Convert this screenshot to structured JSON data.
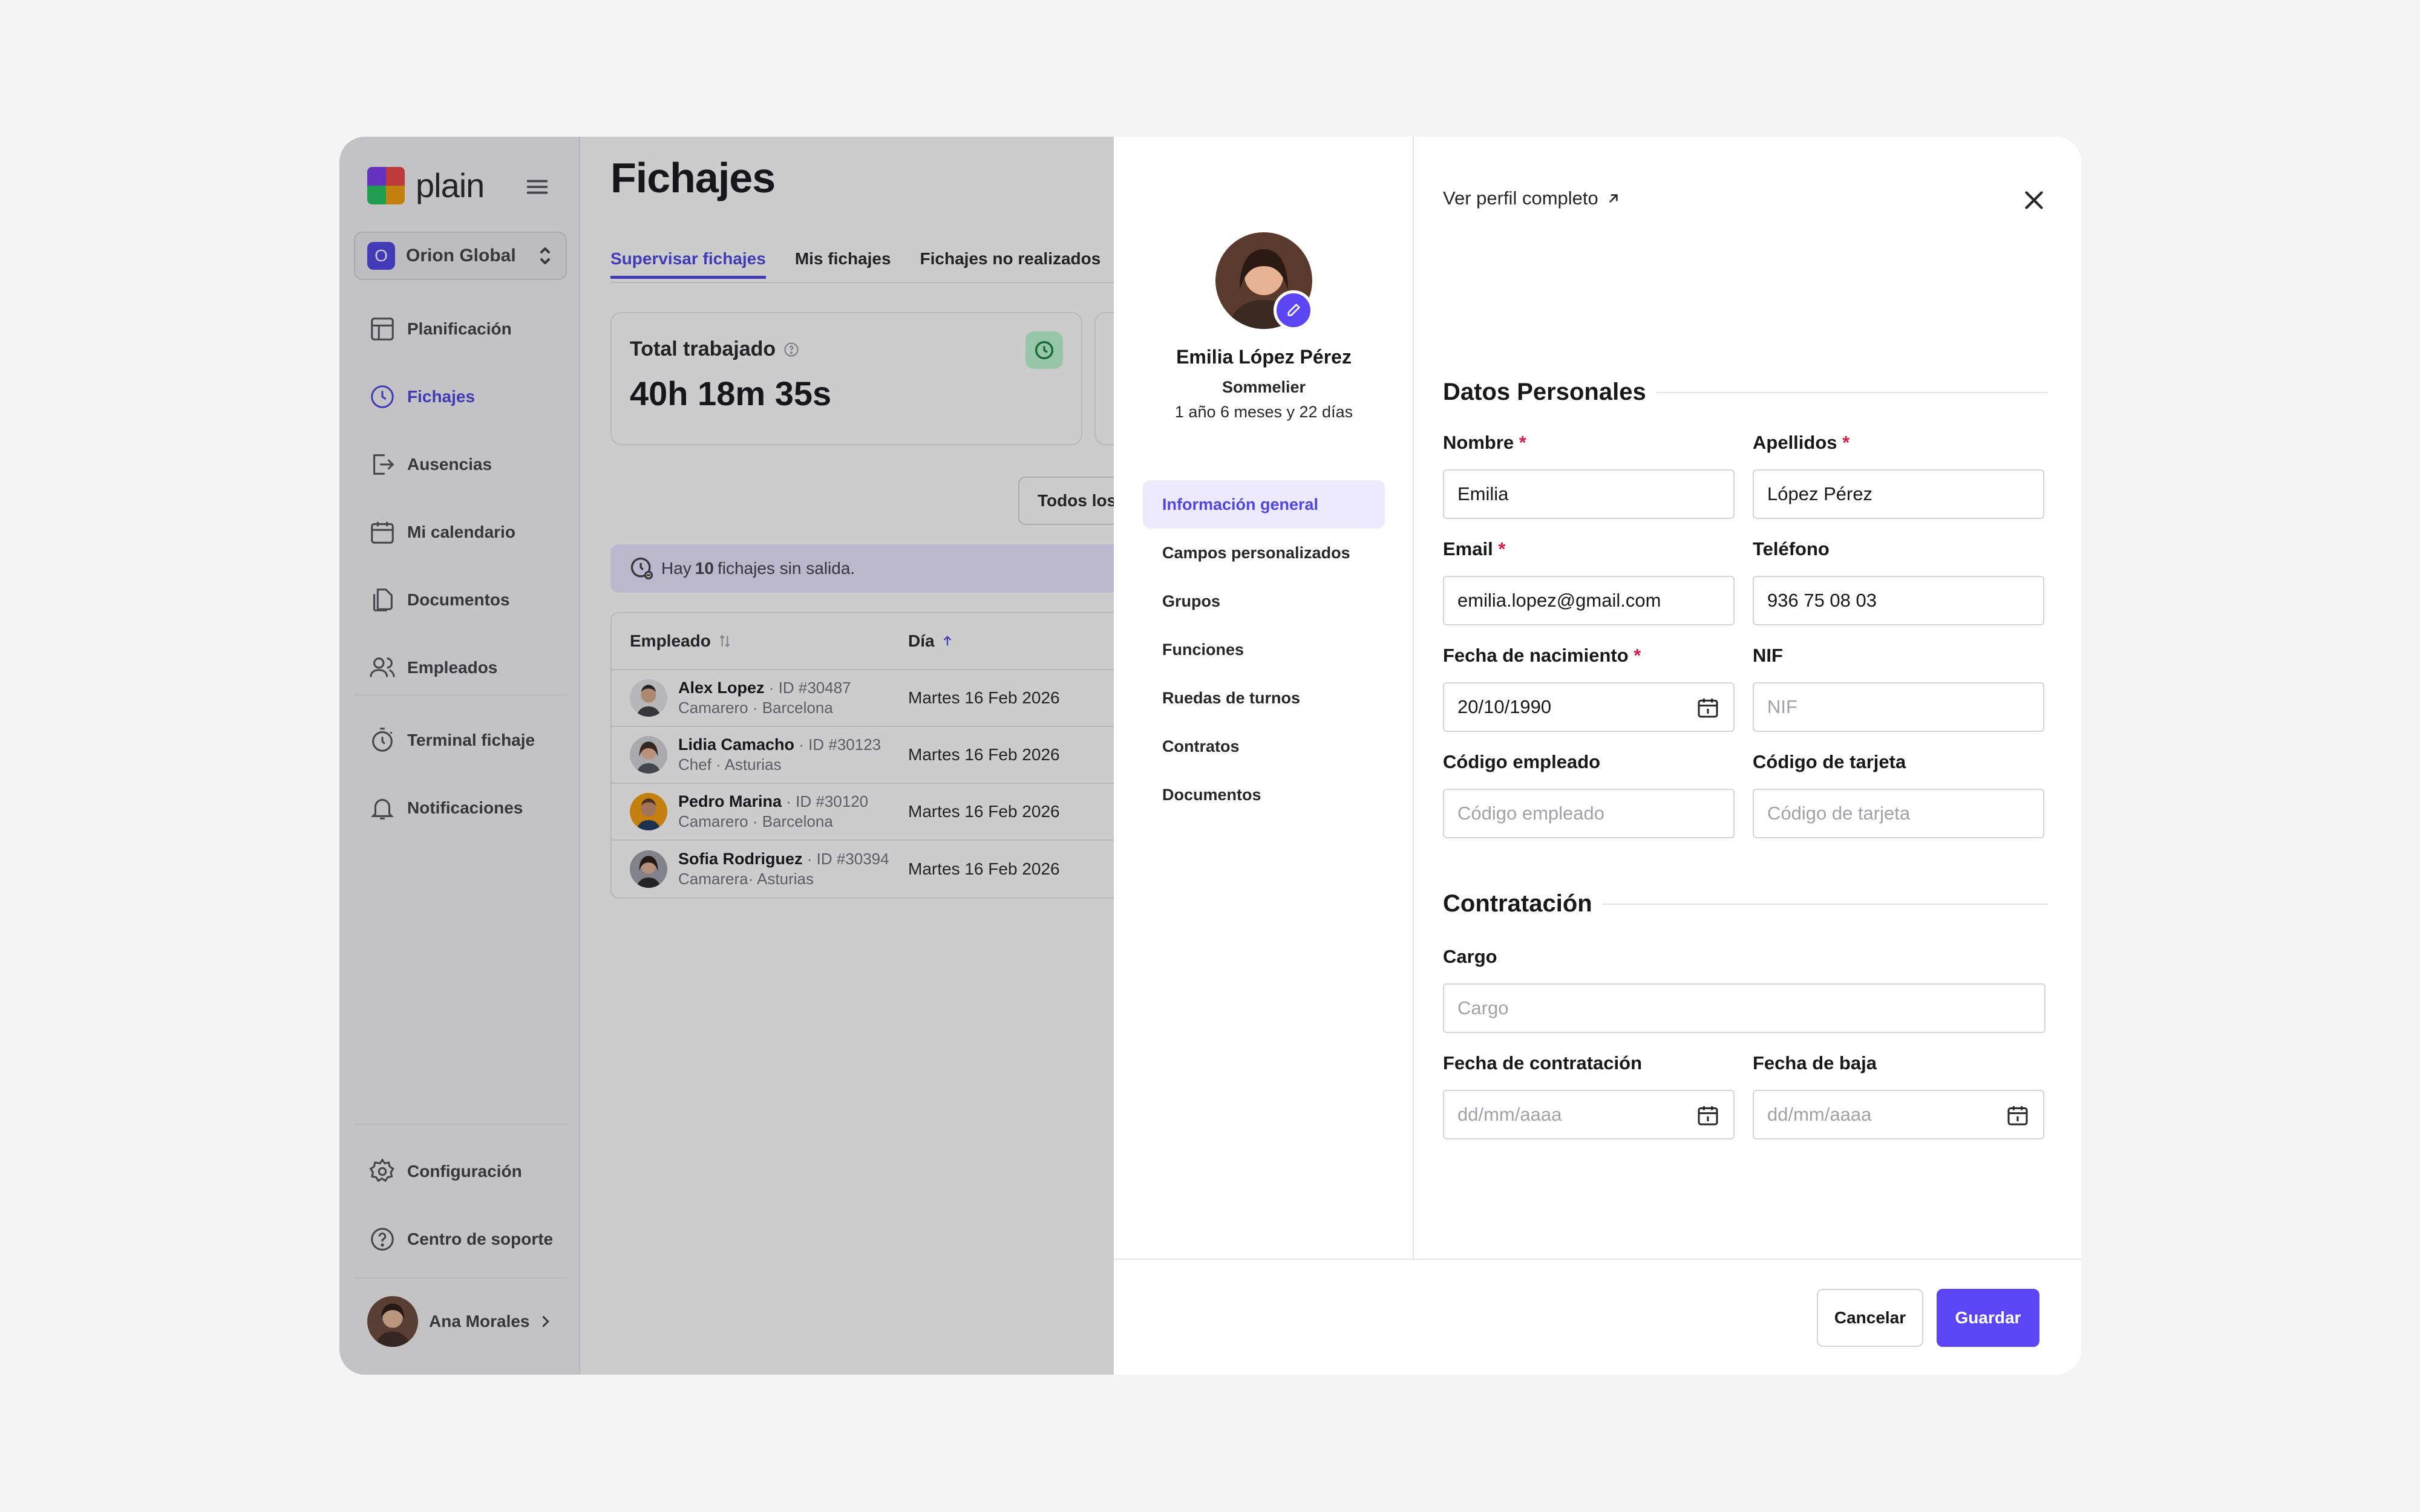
{
  "app": {
    "logo_text": "plain"
  },
  "org": {
    "badge": "O",
    "name": "Orion Global"
  },
  "sidebar": {
    "items": [
      {
        "label": "Planificación",
        "icon": "table-icon"
      },
      {
        "label": "Fichajes",
        "icon": "clock-icon",
        "active": true
      },
      {
        "label": "Ausencias",
        "icon": "logout-icon"
      },
      {
        "label": "Mi calendario",
        "icon": "calendar-icon"
      },
      {
        "label": "Documentos",
        "icon": "documents-icon"
      },
      {
        "label": "Empleados",
        "icon": "users-icon"
      },
      {
        "label": "Terminal fichaje",
        "icon": "stopwatch-icon"
      },
      {
        "label": "Notificaciones",
        "icon": "bell-icon"
      },
      {
        "label": "Configuración",
        "icon": "gear-icon"
      },
      {
        "label": "Centro de soporte",
        "icon": "help-icon"
      }
    ],
    "user": {
      "name": "Ana Morales"
    }
  },
  "main": {
    "title": "Fichajes",
    "tabs": [
      "Supervisar fichajes",
      "Mis fichajes",
      "Fichajes no realizados"
    ],
    "stat": {
      "label": "Total trabajado",
      "value": "40h 18m 35s"
    },
    "filter_label": "Todos los",
    "alert": {
      "prefix": "Hay ",
      "count": "10",
      "suffix": " fichajes sin salida."
    },
    "table": {
      "headers": {
        "employee": "Empleado",
        "day": "Día"
      },
      "rows": [
        {
          "name": "Alex Lopez",
          "id": " · ID #30487",
          "sub": "Camarero · Barcelona",
          "day": "Martes 16 Feb 2026"
        },
        {
          "name": "Lidia Camacho",
          "id": " · ID #30123",
          "sub": "Chef · Asturias",
          "day": "Martes 16 Feb 2026"
        },
        {
          "name": "Pedro Marina",
          "id": " · ID #30120",
          "sub": "Camarero · Barcelona",
          "day": "Martes 16 Feb 2026"
        },
        {
          "name": "Sofia Rodriguez",
          "id": " · ID #30394",
          "sub": "Camarera· Asturias",
          "day": "Martes 16 Feb 2026"
        }
      ]
    }
  },
  "drawer": {
    "profile": {
      "name": "Emilia López Pérez",
      "role": "Sommelier",
      "tenure": "1 año 6 meses y 22 días"
    },
    "menu": [
      "Información general",
      "Campos personalizados",
      "Grupos",
      "Funciones",
      "Ruedas de turnos",
      "Contratos",
      "Documentos"
    ],
    "view_profile": "Ver perfil completo",
    "sections": {
      "personal": "Datos Personales",
      "hiring": "Contratación"
    },
    "fields": {
      "nombre": {
        "label": "Nombre",
        "value": "Emilia",
        "required": "*"
      },
      "apellidos": {
        "label": "Apellidos",
        "value": "López Pérez",
        "required": "*"
      },
      "email": {
        "label": "Email",
        "value": "emilia.lopez@gmail.com",
        "required": "*"
      },
      "telefono": {
        "label": "Teléfono",
        "value": "936 75 08 03"
      },
      "nacimiento": {
        "label": "Fecha de nacimiento",
        "value": "20/10/1990",
        "required": "*"
      },
      "nif": {
        "label": "NIF",
        "placeholder": "NIF"
      },
      "codigo_empleado": {
        "label": "Código empleado",
        "placeholder": "Código empleado"
      },
      "codigo_tarjeta": {
        "label": "Código de tarjeta",
        "placeholder": "Código de tarjeta"
      },
      "cargo": {
        "label": "Cargo",
        "placeholder": "Cargo"
      },
      "fecha_contratacion": {
        "label": "Fecha de contratación",
        "placeholder": "dd/mm/aaaa"
      },
      "fecha_baja": {
        "label": "Fecha de baja",
        "placeholder": "dd/mm/aaaa"
      }
    },
    "buttons": {
      "cancel": "Cancelar",
      "save": "Guardar"
    }
  },
  "colors": {
    "accent": "#5b45f5",
    "active_nav": "#4f46e5",
    "required": "#e11d48"
  }
}
